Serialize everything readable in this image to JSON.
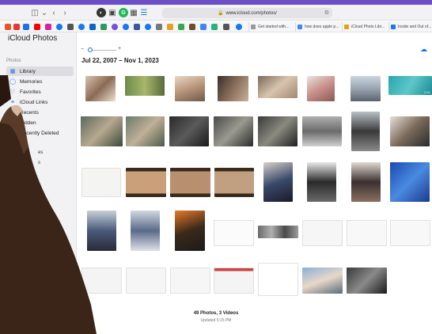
{
  "browser": {
    "url": "www.icloud.com/photos/",
    "bookmark_tabs": [
      {
        "label": "Get started with..."
      },
      {
        "label": "how does apple p..."
      },
      {
        "label": "iCloud Photo Libr..."
      },
      {
        "label": "Inside and Out of..."
      }
    ]
  },
  "app": {
    "title": "iCloud Photos",
    "section": "Photos"
  },
  "sidebar": {
    "items": [
      {
        "label": "Library",
        "icon": "library-icon"
      },
      {
        "label": "Memories",
        "icon": "memories-icon"
      },
      {
        "label": "Favorites",
        "icon": "heart-icon"
      },
      {
        "label": "iCloud Links",
        "icon": "link-icon"
      },
      {
        "label": "Recents",
        "icon": "clock-icon"
      },
      {
        "label": "Hidden",
        "icon": "eye-icon"
      },
      {
        "label": "Recently Deleted",
        "icon": "trash-icon"
      }
    ],
    "partial_items": [
      "es",
      "s"
    ]
  },
  "main": {
    "date_range": "Jul 22, 2007 – Nov 1, 2023",
    "video_duration": "0:41",
    "summary": "49 Photos, 3 Videos",
    "updated": "Updated 5:15 PM"
  },
  "colors": {
    "accent": "#1a73e8",
    "top_strip": "#6a4fc9"
  }
}
